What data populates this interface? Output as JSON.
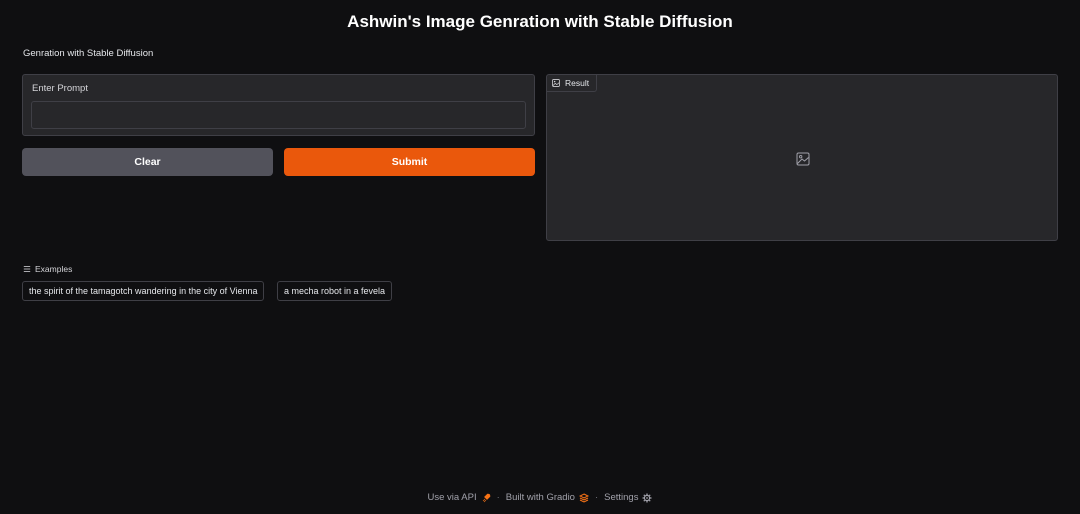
{
  "header": {
    "title": "Ashwin's Image Genration with Stable Diffusion",
    "description": "Genration with Stable Diffusion"
  },
  "prompt": {
    "label": "Enter Prompt",
    "value": "",
    "placeholder": ""
  },
  "buttons": {
    "clear_label": "Clear",
    "submit_label": "Submit"
  },
  "result": {
    "label": "Result",
    "icon": "image-icon",
    "placeholder_icon": "image-placeholder-icon"
  },
  "examples": {
    "label": "Examples",
    "items": [
      "the spirit of the tamagotch wandering in the city of Vienna",
      "a mecha robot in a fevela"
    ]
  },
  "footer": {
    "api_label": "Use via API",
    "built_label": "Built with Gradio",
    "settings_label": "Settings",
    "separator": "·"
  },
  "colors": {
    "background": "#0f0f11",
    "panel": "#27272a",
    "border": "#3f3f46",
    "primary": "#ea580c",
    "secondary": "#52525b"
  }
}
